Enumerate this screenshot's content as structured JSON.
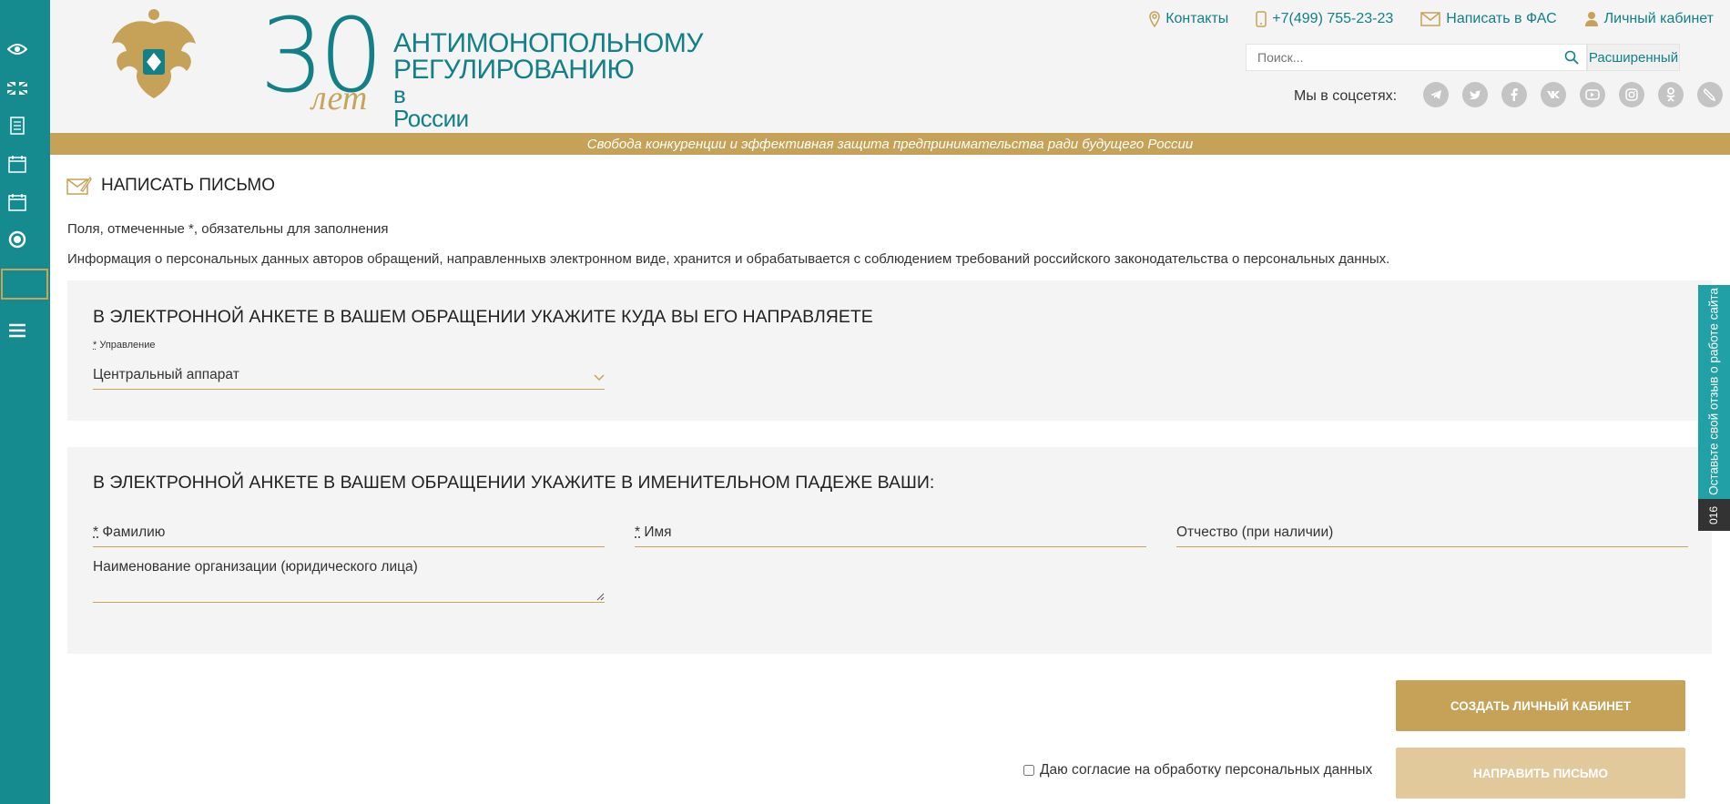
{
  "sidebar": {
    "icons": [
      "eye-icon",
      "uk-flag-icon",
      "document-list-icon",
      "calendar-30-icon",
      "calendar-15-icon",
      "circle-icon",
      "menu-icon"
    ]
  },
  "header": {
    "logo": {
      "number": "30",
      "number_suffix": "лет",
      "line1": "АНТИМОНОПОЛЬНОМУ",
      "line2": "РЕГУЛИРОВАНИЮ",
      "line3": "в России"
    },
    "nav": {
      "contacts": "Контакты",
      "phone": "+7(499) 755-23-23",
      "write_fas": "Написать в ФАС",
      "cabinet": "Личный кабинет"
    },
    "search": {
      "placeholder": "Поиск...",
      "advanced": "Расширенный"
    },
    "social": {
      "label": "Мы в соцсетях:",
      "items": [
        "telegram",
        "twitter",
        "facebook",
        "vk",
        "youtube",
        "instagram",
        "odnoklassniki",
        "livejournal"
      ]
    }
  },
  "slogan": "Свобода конкуренции и эффективная защита предпринимательства ради будущего России",
  "page": {
    "title": "НАПИСАТЬ ПИСЬМО",
    "required_note": "Поля, отмеченные *, обязательны для заполнения",
    "privacy_note": "Информация о персональных данных авторов обращений, направленныхв электронном виде, хранится и обрабатывается с соблюдением требований российского законодательства о персональных данных."
  },
  "section1": {
    "heading": "В ЭЛЕКТРОННОЙ АНКЕТЕ В ВАШЕМ ОБРАЩЕНИИ УКАЖИТЕ КУДА ВЫ ЕГО НАПРАВЛЯЕТЕ",
    "label_req": "*",
    "label": "Управление",
    "value": "Центральный аппарат"
  },
  "section2": {
    "heading": "В ЭЛЕКТРОННОЙ АНКЕТЕ В ВАШЕМ ОБРАЩЕНИИ УКАЖИТЕ В ИМЕНИТЕЛЬНОМ ПАДЕЖЕ ВАШИ:",
    "req": "*",
    "surname": "Фамилию",
    "name": "Имя",
    "patronymic": "Отчество (при наличии)",
    "organization": "Наименование организации (юридического лица)"
  },
  "actions": {
    "create_cabinet": "СОЗДАТЬ ЛИЧНЫЙ КАБИНЕТ",
    "consent": "Даю согласие на обработку персональных данных",
    "send": "НАПРАВИТЬ ПИСЬМО"
  },
  "feedback": {
    "label": "Оставьте свой отзыв о работе сайта",
    "count": "016"
  },
  "colors": {
    "teal": "#158a8f",
    "gold": "#c6a258",
    "gold_light": "#e2c99b"
  }
}
